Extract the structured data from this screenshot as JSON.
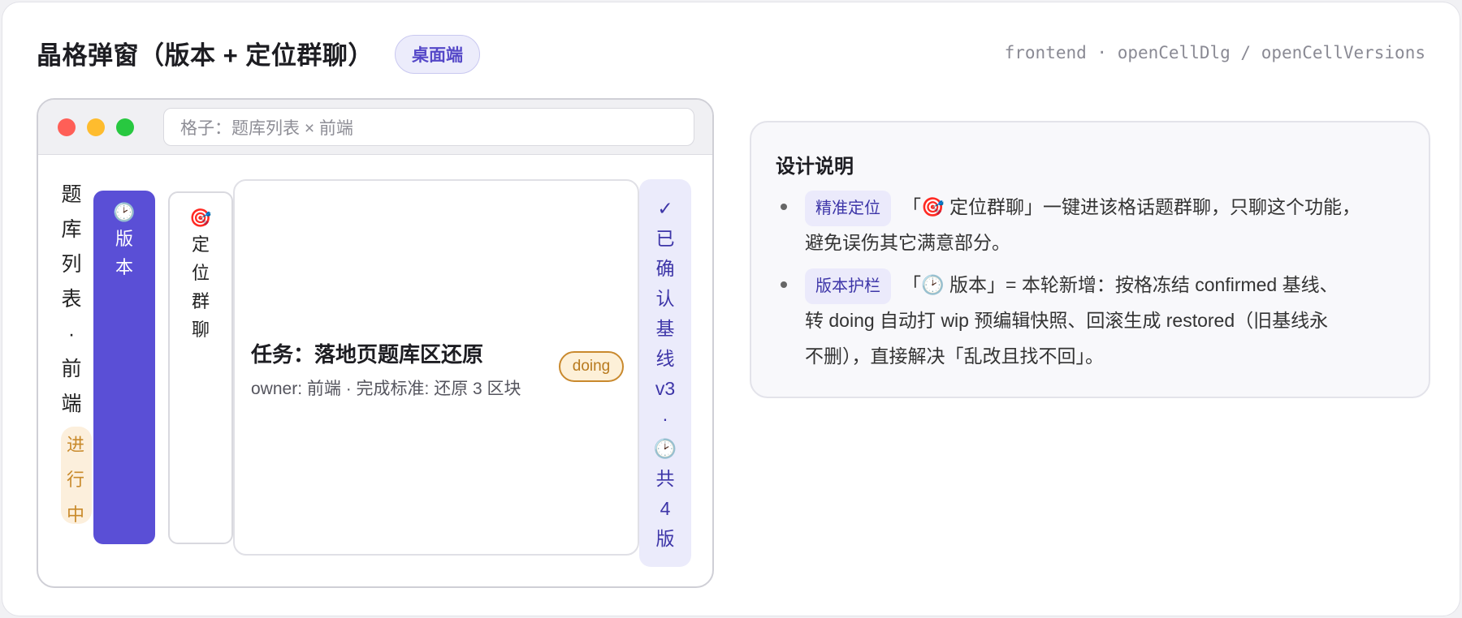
{
  "header": {
    "title": "晶格弹窗（版本 + 定位群聊）",
    "badge": "桌面端",
    "code_path": "frontend · openCellDlg / openCellVersions"
  },
  "window": {
    "address_placeholder": "格子：题库列表 × 前端",
    "cell_title_chars": [
      "题",
      "库",
      "列",
      "表",
      "·",
      "前",
      "端"
    ],
    "status_chars": [
      "进",
      "行",
      "中"
    ],
    "versions_button": {
      "icon": "🕑",
      "chars": [
        "版",
        "本"
      ]
    },
    "locate_button": {
      "icon": "🎯",
      "chars": [
        "定",
        "位",
        "群",
        "聊"
      ]
    },
    "task": {
      "title": "任务：落地页题库区还原",
      "subtitle": "owner: 前端 · 完成标准: 还原 3 区块",
      "status": "doing"
    },
    "baseline_chars": [
      "✓",
      "已",
      "确",
      "认",
      "基",
      "线",
      "v3",
      "·",
      "🕑",
      "共",
      "4",
      "版"
    ]
  },
  "notes": {
    "title": "设计说明",
    "items": [
      {
        "tag": "精准定位",
        "line1": "「🎯 定位群聊」一键进该格话题群聊，只聊这个功能，",
        "line2": "避免误伤其它满意部分。"
      },
      {
        "tag": "版本护栏",
        "line1": "「🕑 版本」= 本轮新增：按格冻结 confirmed 基线、",
        "line2": "转 doing 自动打 wip 预编辑快照、回滚生成 restored（旧基线永",
        "line3": "不删），直接解决「乱改且找不回」。"
      }
    ]
  },
  "colors": {
    "accent": "#5a4fd6",
    "accent_light": "#ebebfb",
    "status_doing": "#c9892d",
    "status_bg": "#fcefdc"
  }
}
